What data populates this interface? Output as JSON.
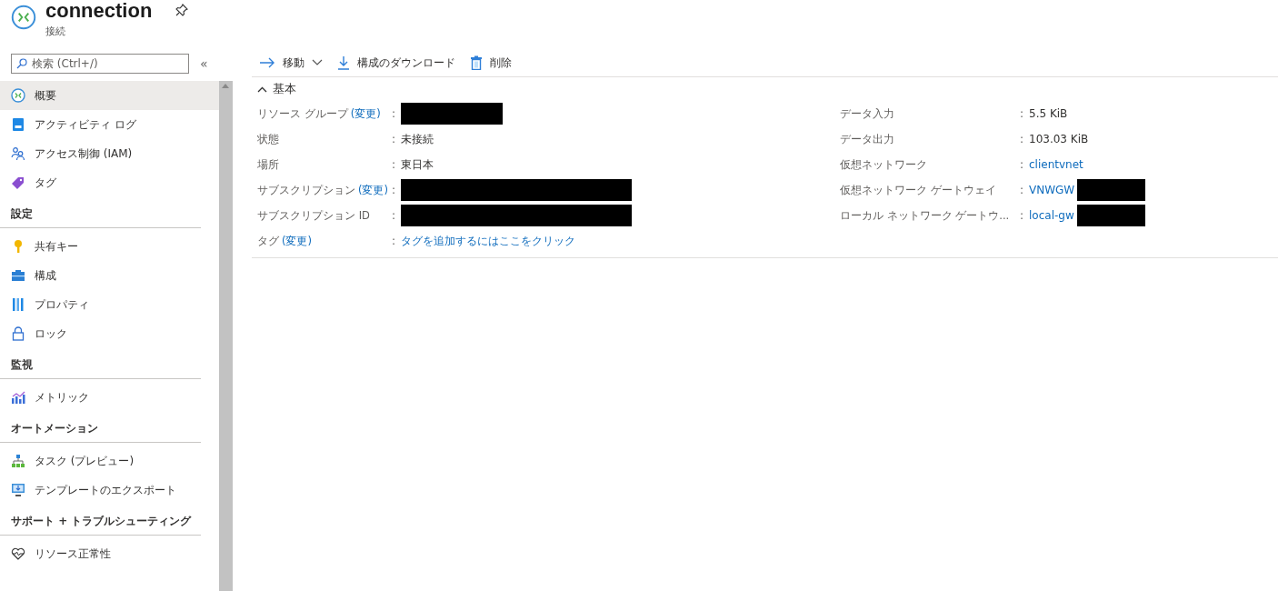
{
  "header": {
    "title": "connection",
    "subtitle": "接続"
  },
  "search": {
    "placeholder": "検索 (Ctrl+/)"
  },
  "collapse": "«",
  "sidebar": [
    {
      "kind": "item",
      "label": "概要",
      "selected": true
    },
    {
      "kind": "item",
      "label": "アクティビティ ログ",
      "selected": false
    },
    {
      "kind": "item",
      "label": "アクセス制御 (IAM)",
      "selected": false
    },
    {
      "kind": "item",
      "label": "タグ",
      "selected": false
    },
    {
      "kind": "section",
      "label": "設定"
    },
    {
      "kind": "item",
      "label": "共有キー",
      "selected": false
    },
    {
      "kind": "item",
      "label": "構成",
      "selected": false
    },
    {
      "kind": "item",
      "label": "プロパティ",
      "selected": false
    },
    {
      "kind": "item",
      "label": "ロック",
      "selected": false
    },
    {
      "kind": "section",
      "label": "監視"
    },
    {
      "kind": "item",
      "label": "メトリック",
      "selected": false
    },
    {
      "kind": "section",
      "label": "オートメーション"
    },
    {
      "kind": "item",
      "label": "タスク (プレビュー)",
      "selected": false
    },
    {
      "kind": "item",
      "label": "テンプレートのエクスポート",
      "selected": false
    },
    {
      "kind": "section",
      "label": "サポート + トラブルシューティング"
    },
    {
      "kind": "item",
      "label": "リソース正常性",
      "selected": false
    }
  ],
  "toolbar": [
    {
      "label": "移動",
      "dropdown": true
    },
    {
      "label": "構成のダウンロード",
      "dropdown": false
    },
    {
      "label": "削除",
      "dropdown": false
    }
  ],
  "essentials": {
    "title": "基本",
    "expanded": true,
    "left": [
      {
        "label": "リソース グループ",
        "change": "(変更)",
        "sep": ":",
        "value": {
          "redacted": true
        }
      },
      {
        "label": "状態",
        "sep": ":",
        "value": {
          "text": "未接続",
          "link": false
        }
      },
      {
        "label": "場所",
        "sep": ":",
        "value": {
          "text": "東日本",
          "link": false
        }
      },
      {
        "label": "サブスクリプション",
        "change": "(変更)",
        "sep": ":",
        "value": {
          "redacted": true
        }
      },
      {
        "label": "サブスクリプション ID",
        "sep": ":",
        "value": {
          "redacted": true
        }
      },
      {
        "label": "タグ",
        "change": "(変更)",
        "sep": ":",
        "value": {
          "text": "タグを追加するにはここをクリック",
          "link": true
        }
      }
    ],
    "right": [
      {
        "label": "データ入力",
        "sep": ":",
        "value": {
          "text": "5.5 KiB",
          "link": false
        }
      },
      {
        "label": "データ出力",
        "sep": ":",
        "value": {
          "text": "103.03 KiB",
          "link": false
        }
      },
      {
        "label": "仮想ネットワーク",
        "sep": ":",
        "value": {
          "text": "clientvnet",
          "link": true
        }
      },
      {
        "label": "仮想ネットワーク ゲートウェイ",
        "sep": ":",
        "value": {
          "text": "VNWGW",
          "link": true,
          "redacted": true
        }
      },
      {
        "label": "ローカル ネットワーク ゲートウ...",
        "sep": ":",
        "value": {
          "text": "local-gw",
          "link": true,
          "redacted": true
        }
      }
    ]
  }
}
